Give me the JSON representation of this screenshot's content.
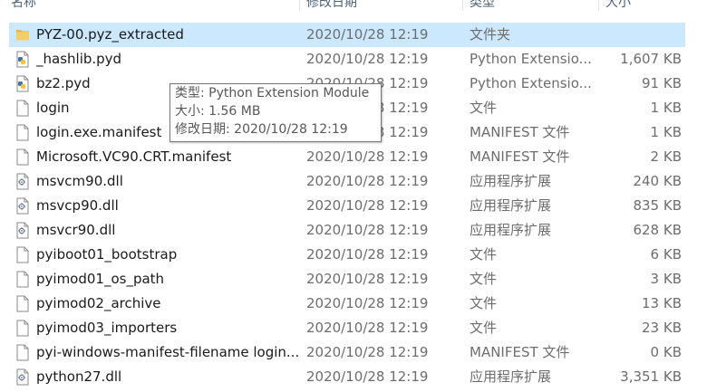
{
  "columns": {
    "name": "名称",
    "date": "修改日期",
    "type": "类型",
    "size": "大小"
  },
  "files": [
    {
      "name": "PYZ-00.pyz_extracted",
      "date": "2020/10/28 12:19",
      "type": "文件夹",
      "size": "",
      "icon": "folder-icon",
      "selected": true
    },
    {
      "name": "_hashlib.pyd",
      "date": "2020/10/28 12:19",
      "type": "Python Extensio...",
      "size": "1,607 KB",
      "icon": "python-file-icon"
    },
    {
      "name": "bz2.pyd",
      "date": "2020/10/28 12:19",
      "type": "Python Extensio...",
      "size": "91 KB",
      "icon": "python-file-icon"
    },
    {
      "name": "login",
      "date": "2020/10/28 12:19",
      "type": "文件",
      "size": "1 KB",
      "icon": "blank-file-icon"
    },
    {
      "name": "login.exe.manifest",
      "date": "2020/10/28 12:19",
      "type": "MANIFEST 文件",
      "size": "1 KB",
      "icon": "blank-file-icon"
    },
    {
      "name": "Microsoft.VC90.CRT.manifest",
      "date": "2020/10/28 12:19",
      "type": "MANIFEST 文件",
      "size": "2 KB",
      "icon": "blank-file-icon"
    },
    {
      "name": "msvcm90.dll",
      "date": "2020/10/28 12:19",
      "type": "应用程序扩展",
      "size": "240 KB",
      "icon": "dll-file-icon"
    },
    {
      "name": "msvcp90.dll",
      "date": "2020/10/28 12:19",
      "type": "应用程序扩展",
      "size": "835 KB",
      "icon": "dll-file-icon"
    },
    {
      "name": "msvcr90.dll",
      "date": "2020/10/28 12:19",
      "type": "应用程序扩展",
      "size": "628 KB",
      "icon": "dll-file-icon"
    },
    {
      "name": "pyiboot01_bootstrap",
      "date": "2020/10/28 12:19",
      "type": "文件",
      "size": "6 KB",
      "icon": "blank-file-icon"
    },
    {
      "name": "pyimod01_os_path",
      "date": "2020/10/28 12:19",
      "type": "文件",
      "size": "3 KB",
      "icon": "blank-file-icon"
    },
    {
      "name": "pyimod02_archive",
      "date": "2020/10/28 12:19",
      "type": "文件",
      "size": "13 KB",
      "icon": "blank-file-icon"
    },
    {
      "name": "pyimod03_importers",
      "date": "2020/10/28 12:19",
      "type": "文件",
      "size": "23 KB",
      "icon": "blank-file-icon"
    },
    {
      "name": "pyi-windows-manifest-filename login...",
      "date": "2020/10/28 12:19",
      "type": "MANIFEST 文件",
      "size": "0 KB",
      "icon": "blank-file-icon"
    },
    {
      "name": "python27.dll",
      "date": "2020/10/28 12:19",
      "type": "应用程序扩展",
      "size": "3,351 KB",
      "icon": "dll-file-icon"
    }
  ],
  "tooltip": {
    "type_line": "类型: Python Extension Module",
    "size_line": "大小: 1.56 MB",
    "date_line": "修改日期: 2020/10/28 12:19"
  },
  "colors": {
    "selection": "#cce8ff",
    "folder": "#e8b94a",
    "python_blue": "#3b73b0",
    "python_yellow": "#f5c53c"
  }
}
